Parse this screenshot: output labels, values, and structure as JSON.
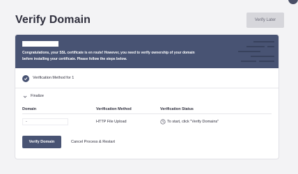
{
  "header": {
    "title": "Verify Domain",
    "verify_later_label": "Verify Later"
  },
  "banner": {
    "message": "Congratulations, your SSL certificate is en route! However, you need to verify ownership of your domain before installing your certificate. Please follow the steps below."
  },
  "method": {
    "label": "Verification Method for 1"
  },
  "finalize": {
    "label": "Finalize"
  },
  "table": {
    "columns": [
      "Domain",
      "Verification Method",
      "Verification Status"
    ],
    "rows": [
      {
        "domain": "-",
        "method": "HTTP File Upload",
        "status": "To start, click \"Verify Domains\""
      }
    ]
  },
  "actions": {
    "verify_label": "Verify Domain",
    "cancel_label": "Cancel Process & Restart"
  },
  "colors": {
    "accent": "#485373",
    "background": "#f3f3f5"
  },
  "icons": {
    "check": "check-circle-icon",
    "chevron": "chevron-down-icon",
    "clock": "clock-icon"
  }
}
